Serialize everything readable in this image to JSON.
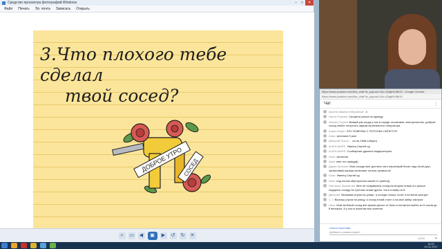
{
  "viewer": {
    "title": "Средство просмотра фотографий Windows",
    "menu": [
      "Файл",
      "Печать",
      "Эл. почта",
      "Записать",
      "Открыть"
    ],
    "heading_line1": "3.Что плохого тебе сделал",
    "heading_line2": "твой сосед?",
    "art_banner1": "ДОБРОЕ УТРО",
    "art_banner2": "СОСЕД"
  },
  "chat_window": {
    "title": "https://www.youtube.com/live_chat?is_popout=1&v=Q9gh9Lf8h10 - Google Chrome",
    "url": "https://www.youtube.com/live_chat?is_popout=1&v=Q9gh9Lf8h10",
    "header": "Чат",
    "messages": [
      {
        "author": "Аксели Авжени Избранный",
        "text": ".л"
      },
      {
        "author": "Настя Рыжина",
        "text": "Сигарета упала на одежду"
      },
      {
        "author": "Увинец Сергей",
        "text": "Всякий раз когда у нас в городе отключают электричество, добрый сосед любит потрогать звуком включенного генератора"
      },
      {
        "author": "Алиан Юрин",
        "text": "ЧТО ПОБЕЛКА С ПОТОЛКА СЫПЕТСЯ"
      },
      {
        "author": "Алиа",
        "text": "затопили 5 раз!"
      },
      {
        "author": "Дмитрий Поспе...",
        "text": "ли на 180в собрал)"
      },
      {
        "author": "ALIEN-MARS",
        "text": "Увинец Сергей хд"
      },
      {
        "author": "ALIEN-MARS",
        "text": "Сообщение удалено модератором"
      },
      {
        "author": "Ника",
        "text": "затопили"
      },
      {
        "author": "Ария",
        "text": "мне это правда))"
      },
      {
        "author": "Дарья Ерохина",
        "text": "Мои соседи мне достали хоть переезжай богин над голой,орут, затапливаю,музыку включают на всю громкость!"
      },
      {
        "author": "Алиа",
        "text": "Увинец Сергей хд"
      },
      {
        "author": "Ника",
        "text": "под полом обустроился какой-то трабоз))"
      },
      {
        "author": "Настасья Лукьянова",
        "text": "Мне не понравился сосед на втором этаже,а я решил подарить соседу на третьем этаже дрель. Хотя я живу на 8."
      },
      {
        "author": "Дмитрий",
        "text": "Вызываю утром на улице, а соседи только стоят и на меня смотрят"
      },
      {
        "author": "1, 2",
        "text": "Выхожу утром на улицу, а сосед тихий стоит и на мой забор смотрит"
      },
      {
        "author": "Ника",
        "text": "Мой злобный сосед всё время кричит от боли и пытается выйти из 5 часов до 8 вечером. А у нас в оконном все сыпется"
      }
    ],
    "input_author": "Ольга Соколова",
    "input_placeholder": "Добавить комментарий...",
    "counter": "0/200"
  },
  "taskbar": {
    "time": "16:21",
    "date": "24.11.2017"
  }
}
